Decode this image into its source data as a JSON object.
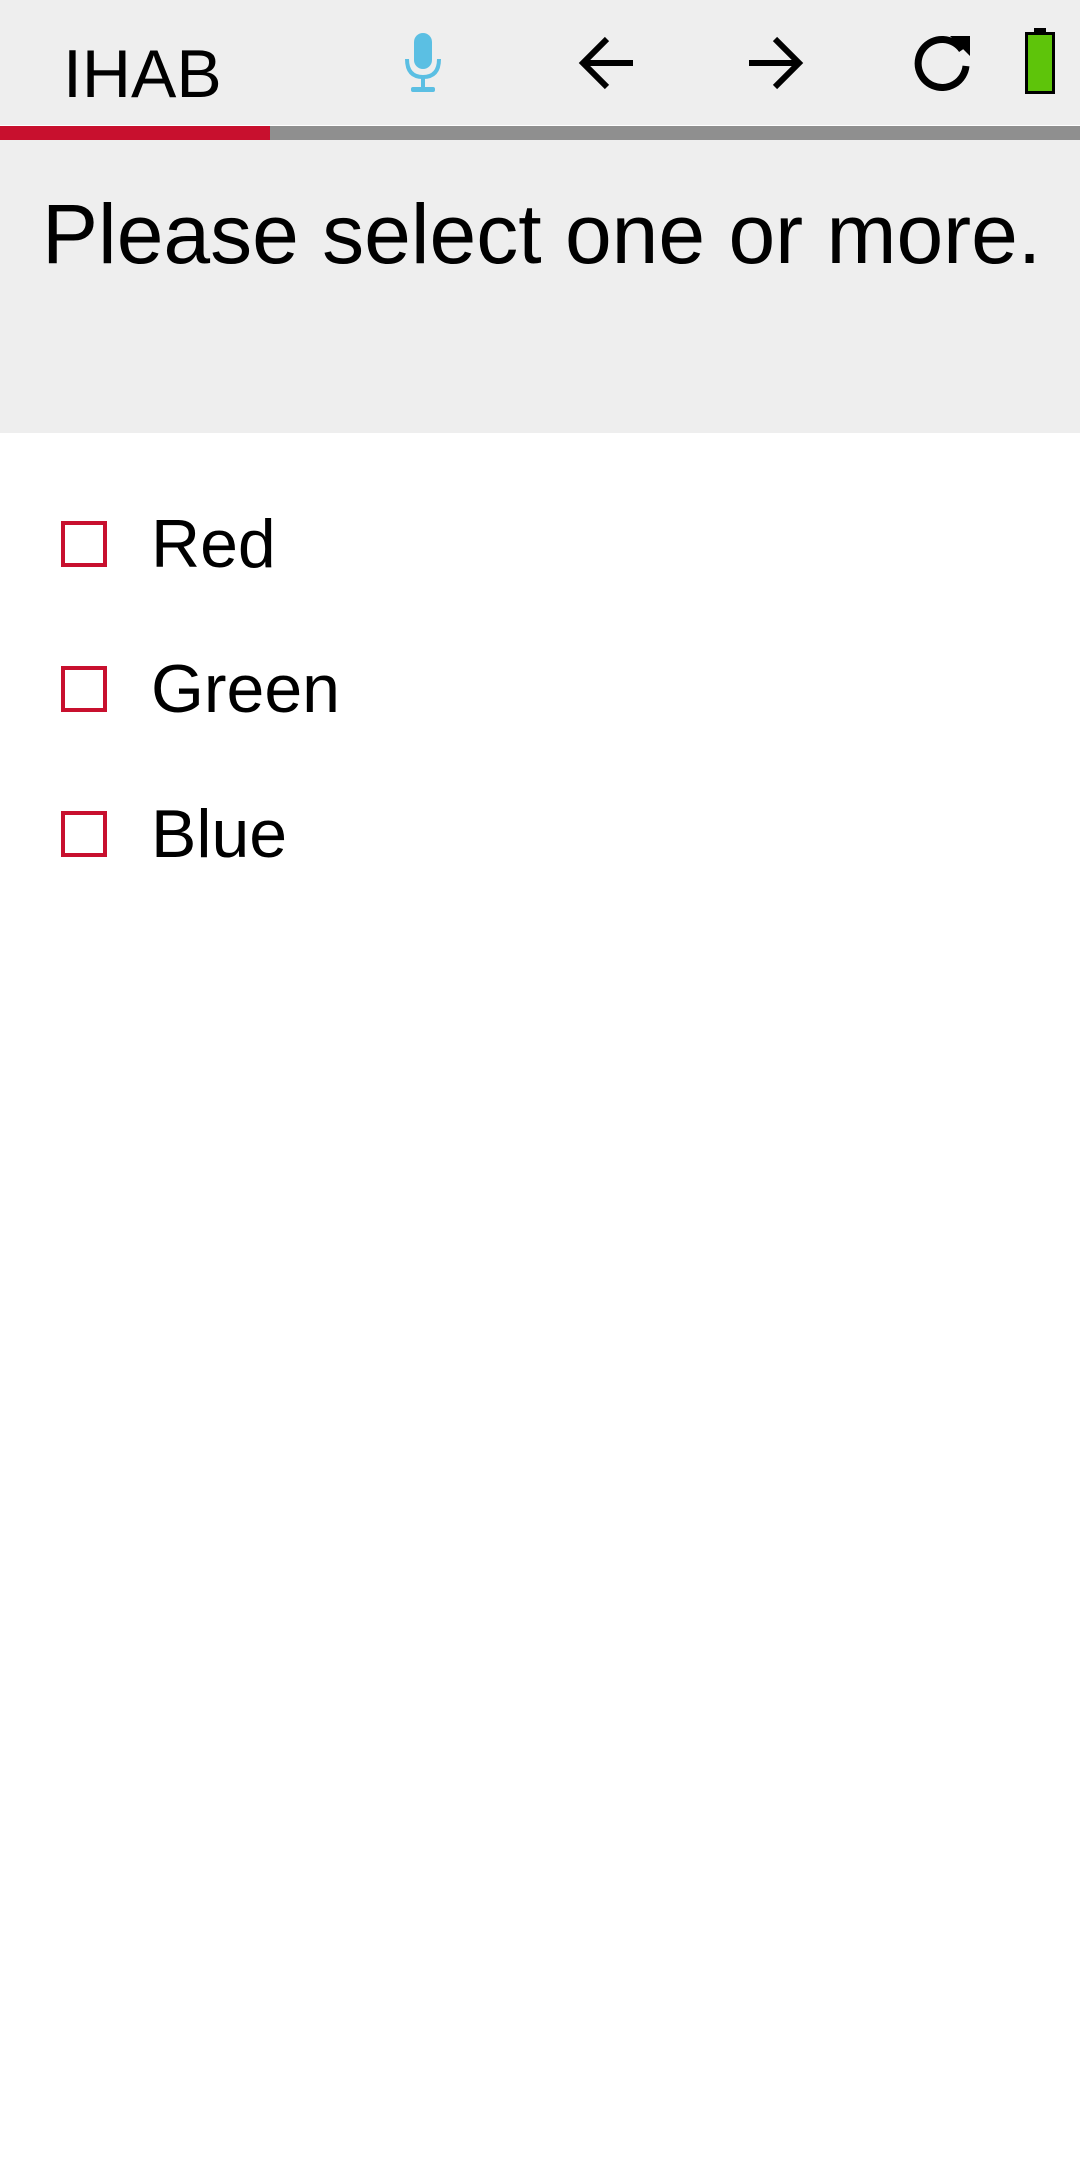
{
  "toolbar": {
    "title": "IHAB",
    "icons": {
      "mic": "microphone-icon",
      "back": "arrow-left-icon",
      "forward": "arrow-right-icon",
      "refresh": "refresh-icon",
      "battery": "battery-icon"
    },
    "battery_level": 1.0
  },
  "progress": {
    "fraction": 0.25
  },
  "question": {
    "text": "Please select one or more."
  },
  "options": [
    {
      "label": "Red",
      "checked": false
    },
    {
      "label": "Green",
      "checked": false
    },
    {
      "label": "Blue",
      "checked": false
    }
  ],
  "colors": {
    "accent": "#c8102e",
    "mic": "#5bbfe3",
    "battery": "#5ec40a",
    "toolbar_bg": "#eeeeee",
    "progress_track": "#8f8f8f"
  }
}
